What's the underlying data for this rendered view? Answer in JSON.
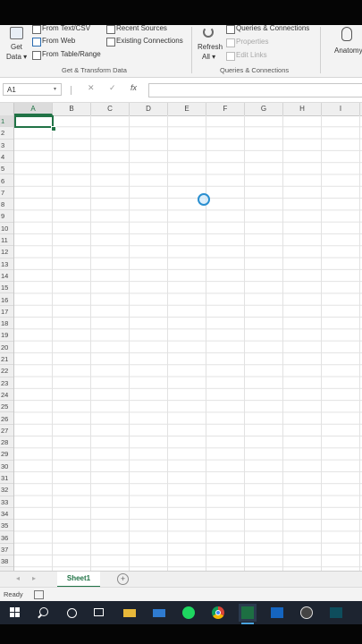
{
  "ribbon": {
    "get_data": "Get\nData",
    "get_data_line1": "Get",
    "get_data_line2": "Data ▾",
    "from_text": "From Text/CSV",
    "from_web": "From Web",
    "from_table": "From Table/Range",
    "recent_sources": "Recent Sources",
    "existing_connections": "Existing Connections",
    "group_get_transform": "Get & Transform Data",
    "refresh_line1": "Refresh",
    "refresh_line2": "All ▾",
    "queries_connections": "Queries & Connections",
    "properties": "Properties",
    "edit_links": "Edit Links",
    "group_queries": "Queries & Connections",
    "anatomy": "Anatomy"
  },
  "formula_bar": {
    "name_box": "A1",
    "cancel": "✕",
    "enter": "✓",
    "fx": "fx",
    "value": ""
  },
  "grid": {
    "columns": [
      "A",
      "B",
      "C",
      "D",
      "E",
      "F",
      "G",
      "H",
      "I"
    ],
    "rows": [
      "1",
      "2",
      "3",
      "4",
      "5",
      "6",
      "7",
      "8",
      "9",
      "10",
      "11",
      "12",
      "13",
      "14",
      "15",
      "16",
      "17",
      "18",
      "19",
      "20",
      "21",
      "22",
      "23",
      "24",
      "25",
      "26",
      "27",
      "28",
      "29",
      "30",
      "31",
      "32",
      "33",
      "34",
      "35",
      "36",
      "37",
      "38"
    ],
    "active_cell": "A1"
  },
  "sheets": {
    "tabs": [
      "Sheet1"
    ],
    "add": "+"
  },
  "status": {
    "ready": "Ready"
  },
  "taskbar": {
    "icons": [
      "windows-icon",
      "search-icon",
      "cortana-icon",
      "task-view-icon",
      "file-explorer-icon",
      "mail-icon",
      "spotify-icon",
      "chrome-icon",
      "excel-icon",
      "outlook-icon",
      "obs-icon",
      "app-icon"
    ]
  }
}
